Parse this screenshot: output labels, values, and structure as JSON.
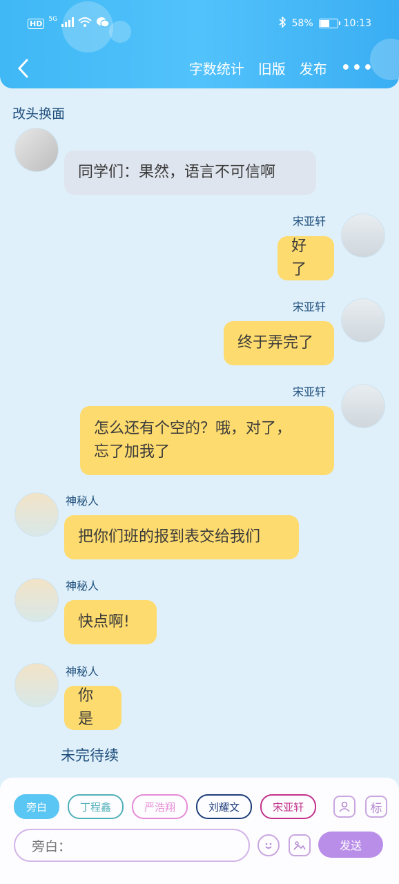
{
  "status_bar": {
    "network_badge": "HD",
    "signal_label": "5G",
    "battery_level": 0.58,
    "battery_text": "58%",
    "time": "10:13"
  },
  "nav": {
    "back_icon": "chevron-left-icon",
    "actions": [
      "字数统计",
      "旧版",
      "发布"
    ],
    "more_icon": "more-dots-icon",
    "more_label": "•••"
  },
  "section_title": "改头换面",
  "messages": [
    {
      "speaker": "",
      "avatar": "ghost-photo-avatar",
      "side": "left",
      "text": "同学们：果然，语言不可信啊",
      "color": "#dfe5ee"
    },
    {
      "speaker": "宋亚轩",
      "avatar": "boy-photo-avatar",
      "side": "right",
      "text": "好了",
      "color": "#fddb6e"
    },
    {
      "speaker": "宋亚轩",
      "avatar": "boy-photo-avatar",
      "side": "right",
      "text": "终于弄完了",
      "color": "#fddb6e"
    },
    {
      "speaker": "宋亚轩",
      "avatar": "boy-photo-avatar",
      "side": "right",
      "text_line1": "怎么还有个空的？哦，对了，",
      "text_line2": "忘了加我了",
      "color": "#fddb6e"
    },
    {
      "speaker": "神秘人",
      "avatar": "cartoon-avatar",
      "side": "left",
      "text": "把你们班的报到表交给我们",
      "color": "#fddb6e"
    },
    {
      "speaker": "神秘人",
      "avatar": "cartoon-avatar",
      "side": "left",
      "text": "快点啊!",
      "color": "#fddb6e"
    },
    {
      "speaker": "神秘人",
      "avatar": "cartoon-avatar",
      "side": "left",
      "text": "你是",
      "color": "#fddb6e"
    }
  ],
  "pending_text": "未完待续",
  "composer": {
    "roles": [
      {
        "label": "旁白",
        "color": "#5ac6f3",
        "active": true
      },
      {
        "label": "丁程鑫",
        "color": "#4fb0b8",
        "active": false
      },
      {
        "label": "严浩翔",
        "color": "#e58ad6",
        "active": false
      },
      {
        "label": "刘耀文",
        "color": "#1d3d7a",
        "active": false
      },
      {
        "label": "宋亚轩",
        "color": "#c2308a",
        "active": false
      }
    ],
    "add_character_icon": "person-card-icon",
    "tag_label": "标",
    "input_placeholder": "旁白：",
    "emoji_icon": "emoji-icon",
    "image_icon": "image-icon",
    "send_label": "发送"
  }
}
